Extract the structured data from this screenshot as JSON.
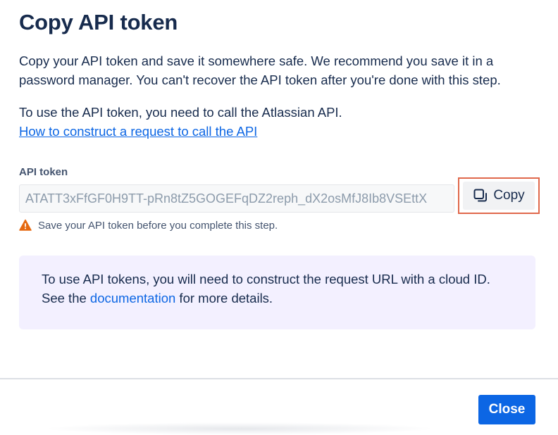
{
  "dialog": {
    "title": "Copy API token",
    "description": "Copy your API token and save it somewhere safe. We recommend you save it in a password manager. You can't recover the API token after you're done with this step.",
    "usage_text": "To use the API token, you need to call the Atlassian API.",
    "usage_link": "How to construct a request to call the API"
  },
  "token_field": {
    "label": "API token",
    "value": "ATATT3xFfGF0H9TT-pRn8tZ5GOGEFqDZ2reph_dX2osMfJ8Ib8VSEttX",
    "copy_label": "Copy",
    "copy_icon": "copy-icon"
  },
  "warning": {
    "icon": "warning-icon",
    "text": "Save your API token before you complete this step."
  },
  "info_panel": {
    "line1": "To use API tokens, you will need to construct the request URL with a cloud ID.",
    "line2_prefix": "See the ",
    "line2_link": "documentation",
    "line2_suffix": " for more details."
  },
  "footer": {
    "close_label": "Close"
  },
  "colors": {
    "brand_blue": "#0c66e4",
    "warning_orange": "#e56910",
    "highlight_border": "#e0684b",
    "info_panel_bg": "#f3f0ff",
    "text_primary": "#172b4d"
  }
}
